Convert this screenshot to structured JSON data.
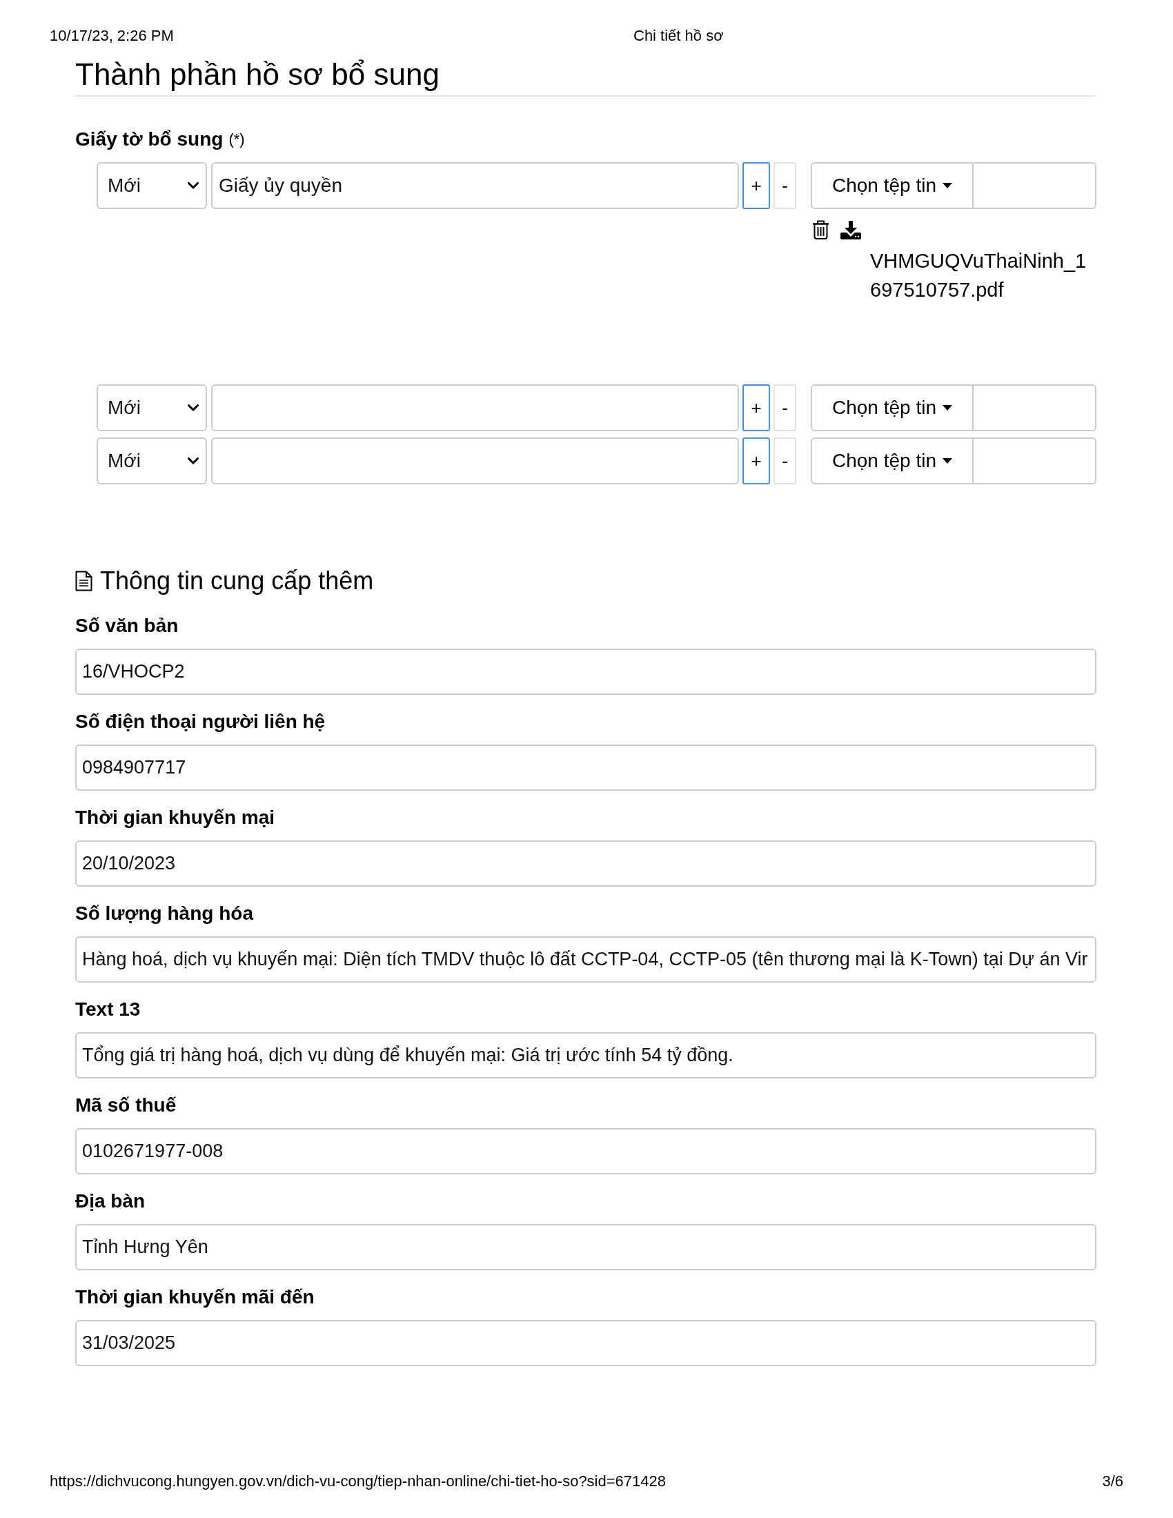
{
  "print_header": {
    "date_time": "10/17/23, 2:26 PM",
    "page_title": "Chi tiết hồ sơ"
  },
  "components": {
    "title": "Thành phần hồ sơ bổ sung",
    "label": "Giấy tờ bổ sung",
    "required_mark": "(*)",
    "rows": [
      {
        "select_value": "Mới",
        "name": "Giấy ủy quyền",
        "add_label": "+",
        "remove_label": "-",
        "file_button": "Chọn tệp tin",
        "attachment": "VHMGUQVuThaiNinh_1697510757.pdf"
      },
      {
        "select_value": "Mới",
        "add_label": "+",
        "remove_label": "-",
        "file_button": "Chọn tệp tin"
      },
      {
        "select_value": "Mới",
        "add_label": "+",
        "remove_label": "-",
        "file_button": "Chọn tệp tin"
      }
    ]
  },
  "additional_info": {
    "title": "Thông tin cung cấp thêm",
    "fields": [
      {
        "label": "Số văn bản",
        "value": "16/VHOCP2"
      },
      {
        "label": "Số điện thoại người liên hệ",
        "value": "0984907717"
      },
      {
        "label": "Thời gian khuyến mại",
        "value": "20/10/2023"
      },
      {
        "label": "Số lượng hàng hóa",
        "value": "Hàng hoá, dịch vụ khuyến mại: Diện tích TMDV thuộc lô đất CCTP-04, CCTP-05 (tên thương mại là K-Town) tại Dự án Vir"
      },
      {
        "label": "Text 13",
        "value": "Tổng giá trị hàng hoá, dịch vụ dùng để khuyến mại: Giá trị ước tính 54 tỷ đồng."
      },
      {
        "label": "Mã số thuế",
        "value": "0102671977-008"
      },
      {
        "label": "Địa bàn",
        "value": "Tỉnh Hưng Yên"
      },
      {
        "label": "Thời gian khuyến mãi đến",
        "value": "31/03/2025"
      }
    ]
  },
  "print_footer": {
    "url": "https://dichvucong.hungyen.gov.vn/dich-vu-cong/tiep-nhan-online/chi-tiet-ho-so?sid=671428",
    "page": "3/6"
  }
}
